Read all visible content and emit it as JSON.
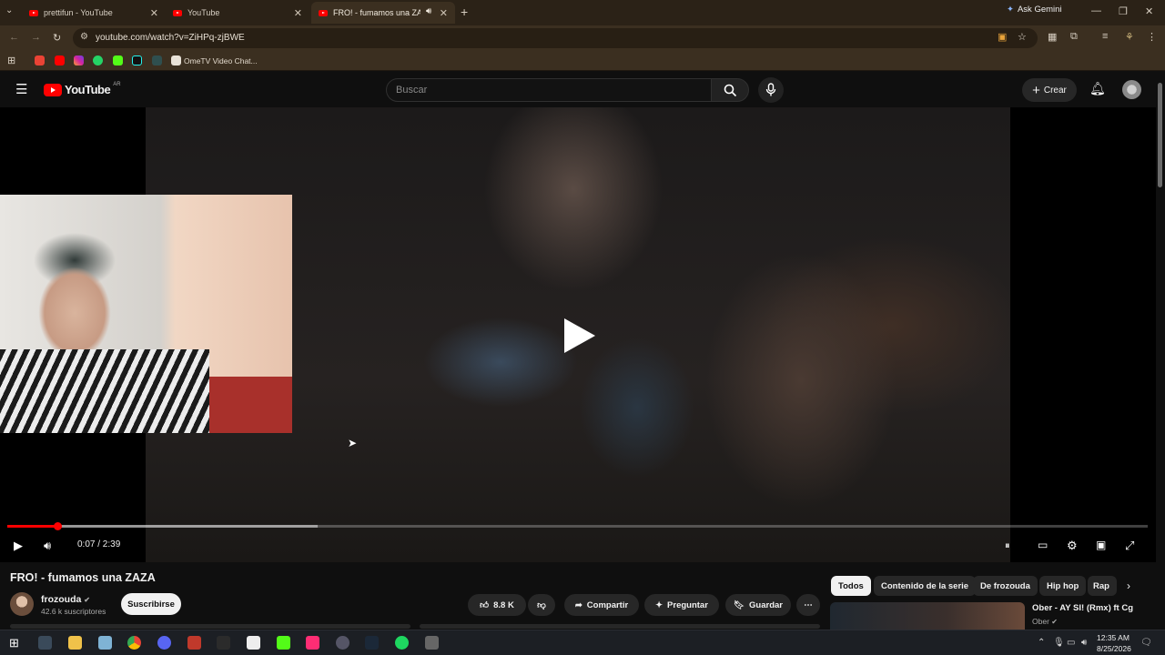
{
  "browser": {
    "tabs": [
      {
        "title": "prettifun - YouTube"
      },
      {
        "title": "YouTube"
      },
      {
        "title": "FRO! - fumamos una ZAZA"
      }
    ],
    "ask_gemini": "Ask Gemini",
    "url": "youtube.com/watch?v=ZiHPq-zjBWE",
    "bookmark_label": "OmeTV Video Chat..."
  },
  "youtube": {
    "logo_text": "YouTube",
    "region": "AR",
    "search_placeholder": "Buscar",
    "create_label": "Crear"
  },
  "player": {
    "time": "0:07 / 2:39",
    "progress_fraction": 0.044,
    "buffered_fraction": 0.272
  },
  "video": {
    "title": "FRO! - fumamos una ZAZA",
    "channel": "frozouda",
    "subscribers": "42.6 k suscriptores",
    "subscribe_label": "Suscribirse",
    "likes": "8.8 K",
    "share_label": "Compartir",
    "ask_label": "Preguntar",
    "save_label": "Guardar"
  },
  "chips": [
    "Todos",
    "Contenido de la serie",
    "De frozouda",
    "Hip hop",
    "Rap"
  ],
  "recommendation": {
    "title": "Ober - AY SI! (Rmx) ft Cg",
    "channel": "Ober"
  },
  "taskbar": {
    "time": "12:35 AM",
    "date": "8/25/2026"
  },
  "colors": {
    "accent": "#ff0000",
    "browser_frame": "#3b2f20",
    "page_bg": "#0f0f0f"
  }
}
